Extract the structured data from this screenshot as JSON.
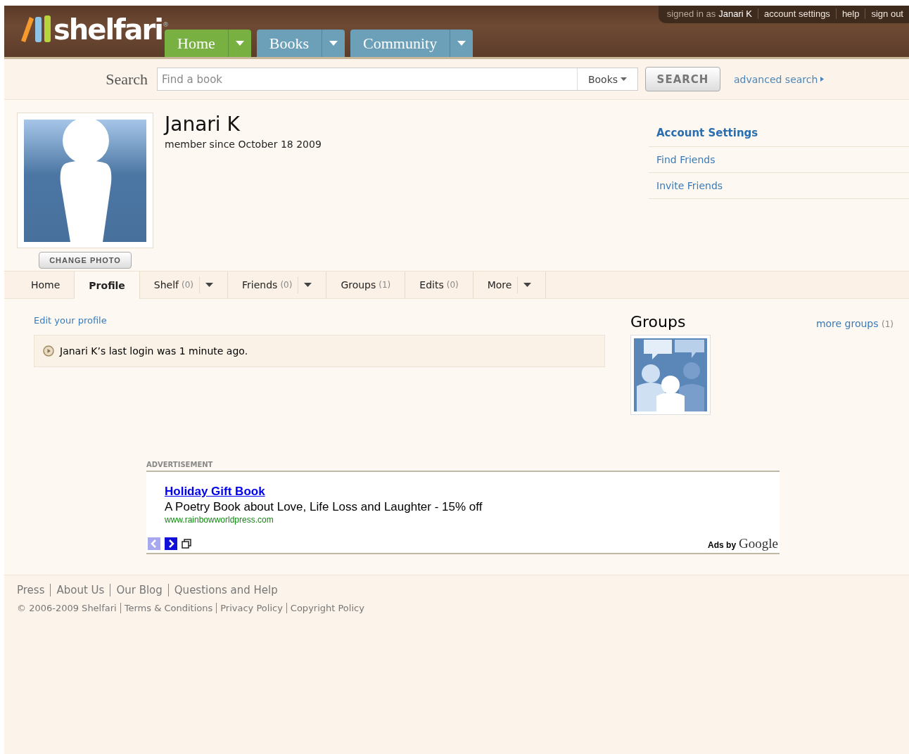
{
  "header": {
    "logo": "shelfari",
    "logo_mark": "®",
    "nav_tabs": [
      {
        "label": "Home",
        "selected": true
      },
      {
        "label": "Books",
        "selected": false
      },
      {
        "label": "Community",
        "selected": false
      }
    ],
    "user_links": {
      "signed_in_label": "signed in as",
      "user_name": "Janari K",
      "links": [
        "account settings",
        "help",
        "sign out"
      ]
    }
  },
  "search": {
    "label": "Search",
    "placeholder": "Find a book",
    "scope": "Books",
    "button": "SEARCH",
    "advanced": "advanced search"
  },
  "profile": {
    "name": "Janari K",
    "member_since": "member since October 18 2009",
    "change_photo": "CHANGE PHOTO"
  },
  "account_menu": [
    {
      "label": "Account Settings",
      "kind": "heading"
    },
    {
      "label": "Find Friends",
      "kind": "link"
    },
    {
      "label": "Invite Friends",
      "kind": "link"
    }
  ],
  "profile_tabs": [
    {
      "label": "Home",
      "selected": false,
      "has_menu": false
    },
    {
      "label": "Profile",
      "selected": true,
      "has_menu": false
    },
    {
      "label": "Shelf",
      "count": "(0)",
      "selected": false,
      "has_menu": true
    },
    {
      "label": "Friends",
      "count": "(0)",
      "selected": false,
      "has_menu": true
    },
    {
      "label": "Groups",
      "count": "(1)",
      "selected": false,
      "has_menu": false
    },
    {
      "label": "Edits",
      "count": "(0)",
      "selected": false,
      "has_menu": false
    },
    {
      "label": "More",
      "selected": false,
      "has_menu": true
    }
  ],
  "edit_profile": "Edit your profile",
  "last_login": "Janari K’s last login was 1 minute ago.",
  "groups": {
    "title": "Groups",
    "more": "more groups",
    "more_count": "(1)"
  },
  "ad": {
    "label": "ADVERTISEMENT",
    "title": "Holiday Gift Book",
    "text": "A Poetry Book about Love, Life Loss and Laughter - 15% off",
    "url": "www.rainbowworldpress.com",
    "ads_by": "Ads by",
    "google": "Google"
  },
  "footer": {
    "links": [
      "Press",
      "About Us",
      "Our Blog",
      "Questions and Help"
    ],
    "copyright": "© 2006-2009 Shelfari",
    "legal": [
      "Terms & Conditions",
      "Privacy Policy",
      "Copyright Policy"
    ]
  }
}
